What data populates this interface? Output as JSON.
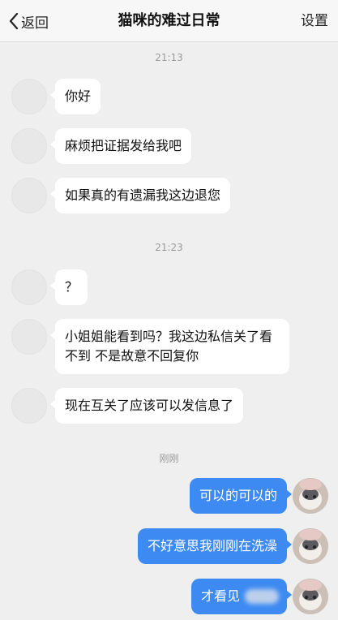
{
  "header": {
    "back_label": "返回",
    "title": "猫咪的难过日常",
    "settings_label": "设置"
  },
  "timestamps": [
    "21:13",
    "21:23",
    "刚刚"
  ],
  "messages_in": [
    "你好",
    "麻烦把证据发给我吧",
    "如果真的有遗漏我这边退您",
    "？",
    "小姐姐能看到吗？我这边私信关了看不到 不是故意不回复你",
    "现在互关了应该可以发信息了"
  ],
  "messages_out": [
    "可以的可以的",
    "不好意思我刚刚在洗澡",
    "才看见"
  ],
  "colors": {
    "background": "#efeff0",
    "bubble_in": "#ffffff",
    "bubble_out": "#3d8bf2"
  }
}
